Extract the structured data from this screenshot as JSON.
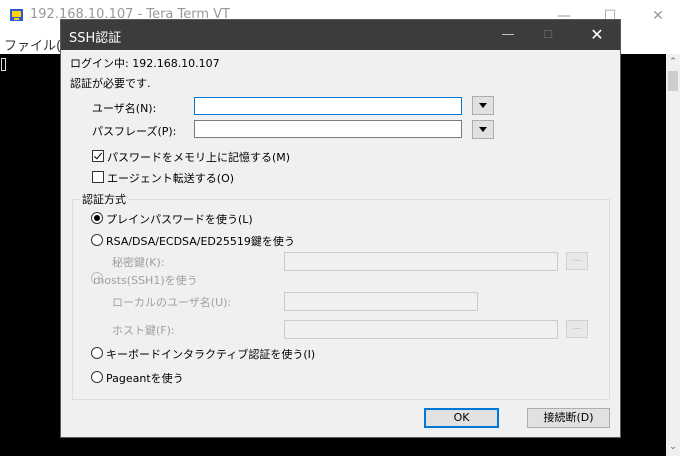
{
  "background_window": {
    "title": "192.168.10.107 - Tera Term VT",
    "menu_file": "ファイル(F",
    "min_glyph": "—",
    "max_glyph": "☐",
    "close_glyph": "✕",
    "scroll_up_glyph": "⌃",
    "scroll_down_glyph": "⌄",
    "app_icon": "tera-term-icon"
  },
  "dialog": {
    "title": "SSH認証",
    "min_glyph": "—",
    "max_glyph": "☐",
    "close_glyph": "✕",
    "login_status": "ログイン中: 192.168.10.107",
    "auth_required": "認証が必要です.",
    "username_label": "ユーザ名(N):",
    "username_value": "",
    "passphrase_label": "パスフレーズ(P):",
    "passphrase_value": "",
    "remember_password_label": "パスワードをメモリ上に記憶する(M)",
    "remember_password_checked": true,
    "agent_forward_label": "エージェント転送する(O)",
    "agent_forward_checked": false,
    "auth_method_group": "認証方式",
    "methods": {
      "plain_password": "プレインパスワードを使う(L)",
      "rsa_key": "RSA/DSA/ECDSA/ED25519鍵を使う",
      "private_key_label": "秘密鍵(K):",
      "rhosts": "rhosts(SSH1)を使う",
      "local_user_label": "ローカルのユーザ名(U):",
      "host_key_label": "ホスト鍵(F):",
      "keyboard_interactive": "キーボードインタラクティブ認証を使う(I)",
      "pageant": "Pageantを使う"
    },
    "selected_method": "plain_password",
    "browse_label": "...",
    "ok_label": "OK",
    "disconnect_label": "接続断(D)"
  },
  "colors": {
    "terminal_bg": "#000000",
    "dialog_title_bg": "#3c3c3c",
    "focus_border": "#0078d7"
  }
}
